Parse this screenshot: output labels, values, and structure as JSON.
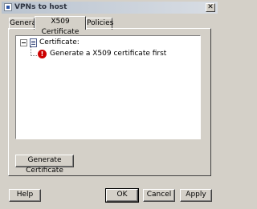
{
  "window": {
    "title": "VPNs to host",
    "close_glyph": "✕"
  },
  "tabs": [
    {
      "label": "General",
      "active": false
    },
    {
      "label": "X509 Certificate",
      "active": true
    },
    {
      "label": "Policies",
      "active": false
    }
  ],
  "tree": {
    "root_label": "Certificate:",
    "root_icon": "certificate-icon",
    "child_label": "Generate a X509 certificate first",
    "child_icon": "error-icon",
    "error_glyph": "!"
  },
  "buttons": {
    "generate": "Generate Certificate",
    "help": "Help",
    "ok": "OK",
    "cancel": "Cancel",
    "apply": "Apply"
  }
}
